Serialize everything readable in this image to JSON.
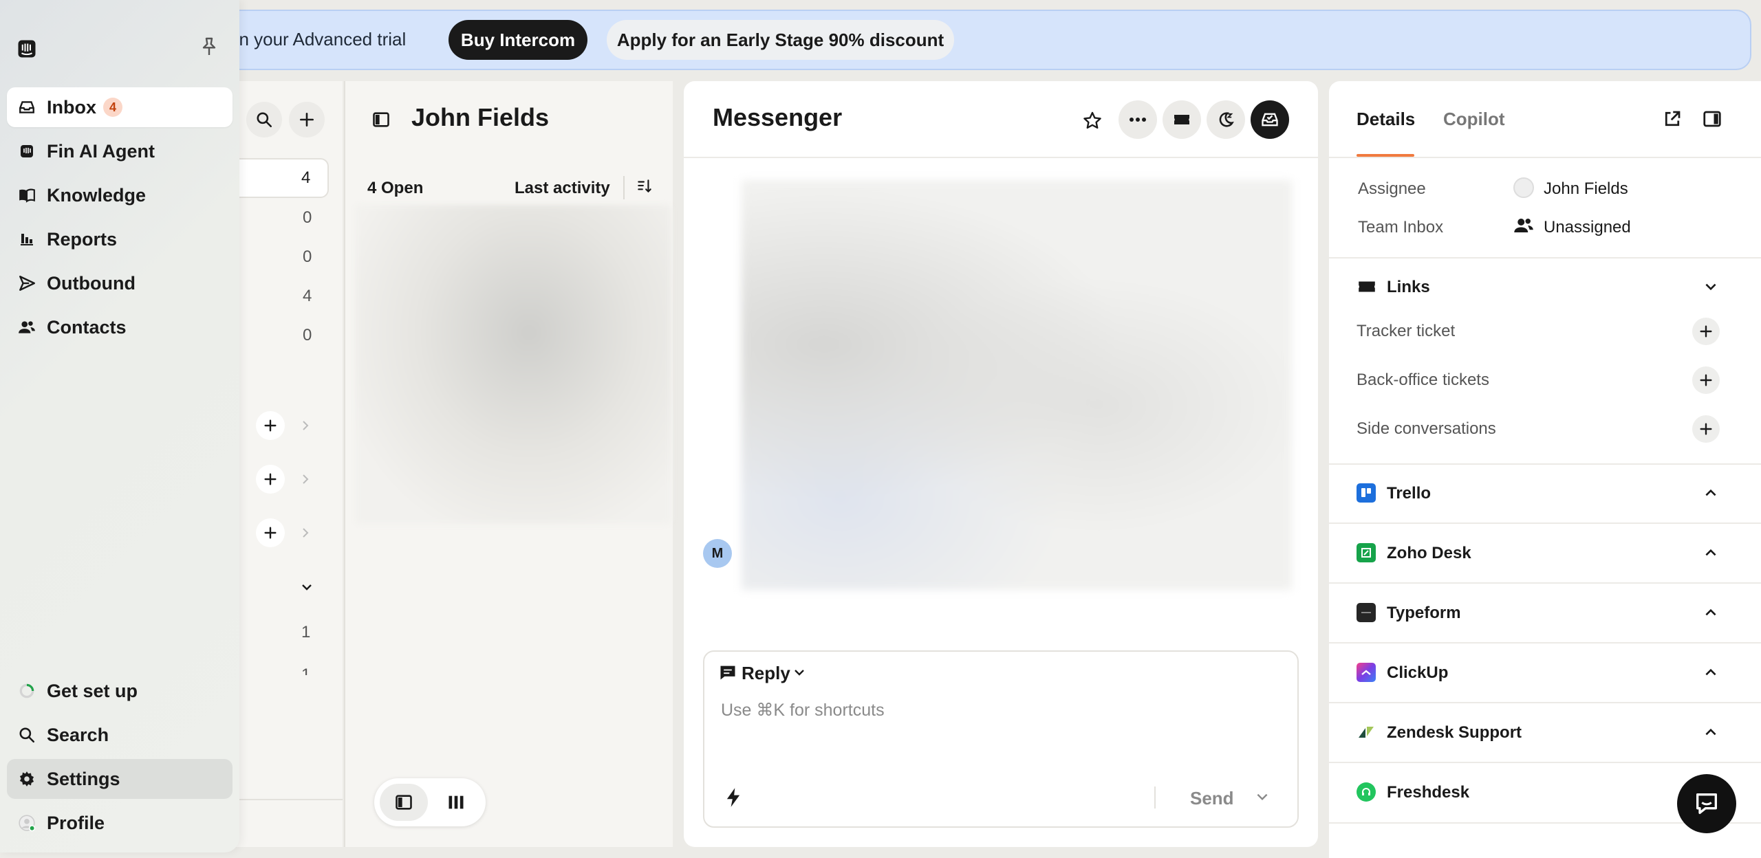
{
  "banner": {
    "text": "ft in your Advanced trial",
    "buy_label": "Buy Intercom",
    "early_label": "Apply for an Early Stage 90% discount"
  },
  "nav": {
    "items": [
      {
        "label": "Inbox",
        "badge": "4",
        "icon": "inbox-icon"
      },
      {
        "label": "Fin AI Agent",
        "icon": "fin-icon"
      },
      {
        "label": "Knowledge",
        "icon": "book-icon"
      },
      {
        "label": "Reports",
        "icon": "bar-chart-icon"
      },
      {
        "label": "Outbound",
        "icon": "send-icon"
      },
      {
        "label": "Contacts",
        "icon": "contacts-icon"
      }
    ],
    "bottom_items": [
      {
        "label": "Get set up",
        "icon": "progress-ring-icon"
      },
      {
        "label": "Search",
        "icon": "search-icon"
      },
      {
        "label": "Settings",
        "icon": "gear-icon"
      },
      {
        "label": "Profile",
        "icon": "avatar"
      }
    ]
  },
  "inbox_counts": [
    "4",
    "0",
    "0",
    "4",
    "0"
  ],
  "inbox_counts_lower": [
    "1",
    "1"
  ],
  "conversation_list": {
    "title": "John Fields",
    "open_label": "4 Open",
    "sort_label": "Last activity"
  },
  "messenger": {
    "title": "Messenger",
    "avatar_letter": "M",
    "reply_label": "Reply",
    "placeholder": "Use ⌘K for shortcuts",
    "send_label": "Send"
  },
  "details": {
    "tabs": [
      "Details",
      "Copilot"
    ],
    "assignee_label": "Assignee",
    "assignee_value": "John Fields",
    "team_label": "Team Inbox",
    "team_value": "Unassigned",
    "links_title": "Links",
    "links": [
      "Tracker ticket",
      "Back-office tickets",
      "Side conversations"
    ],
    "apps": [
      {
        "name": "Trello",
        "color": "#1d6fdc"
      },
      {
        "name": "Zoho Desk",
        "color": "#16a34a"
      },
      {
        "name": "Typeform",
        "color": "#262626"
      },
      {
        "name": "ClickUp",
        "color": "#7b3fe4"
      },
      {
        "name": "Zendesk Support",
        "color": "#1f4e3d"
      },
      {
        "name": "Freshdesk",
        "color": "#22c55e"
      }
    ]
  },
  "colors": {
    "accent_orange": "#f07a3f",
    "banner_bg": "#d6e4fb",
    "badge_bg": "#fbd7c8"
  }
}
